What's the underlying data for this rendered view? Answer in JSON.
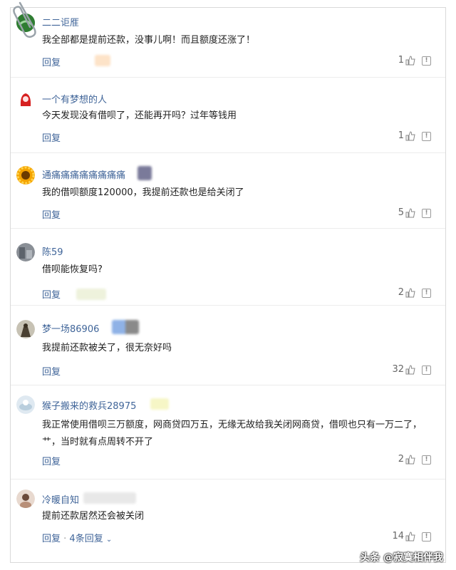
{
  "comments": [
    {
      "name": "二二讵㕍",
      "text": "我全部都是提前还款，没事儿啊！而且额度还涨了！",
      "reply": "回复",
      "reply_count": "",
      "likes": "1"
    },
    {
      "name": "一个有梦想的人",
      "text": "今天发现没有借呗了，还能再开吗？过年等钱用",
      "reply": "回复",
      "reply_count": "",
      "likes": "1"
    },
    {
      "name": "通痛痛痛痛痛痛痛痛",
      "text": "我的借呗额度120000，我提前还款也是给关闭了",
      "reply": "回复",
      "reply_count": "",
      "likes": "5"
    },
    {
      "name": "陈59",
      "text": "借呗能恢复吗?",
      "reply": "回复",
      "reply_count": "",
      "likes": "2"
    },
    {
      "name": "梦一场86906",
      "text": "我提前还款被关了，很无奈好吗",
      "reply": "回复",
      "reply_count": "",
      "likes": "32"
    },
    {
      "name": "猴子搬来的救兵28975",
      "text": "我正常使用借呗三万额度，网商贷四万五，无缘无故给我关闭网商贷，借呗也只有一万二了，艹，当时就有点周转不开了",
      "reply": "回复",
      "reply_count": "",
      "likes": "2"
    },
    {
      "name": "冷暖自知",
      "text": "提前还款居然还会被关闭",
      "reply": "回复",
      "reply_count": "4条回复",
      "likes": "14"
    }
  ],
  "watermark": "头条 @寂寞相伴我",
  "colors": {
    "link": "#406599",
    "text": "#222222",
    "muted": "#666666"
  }
}
